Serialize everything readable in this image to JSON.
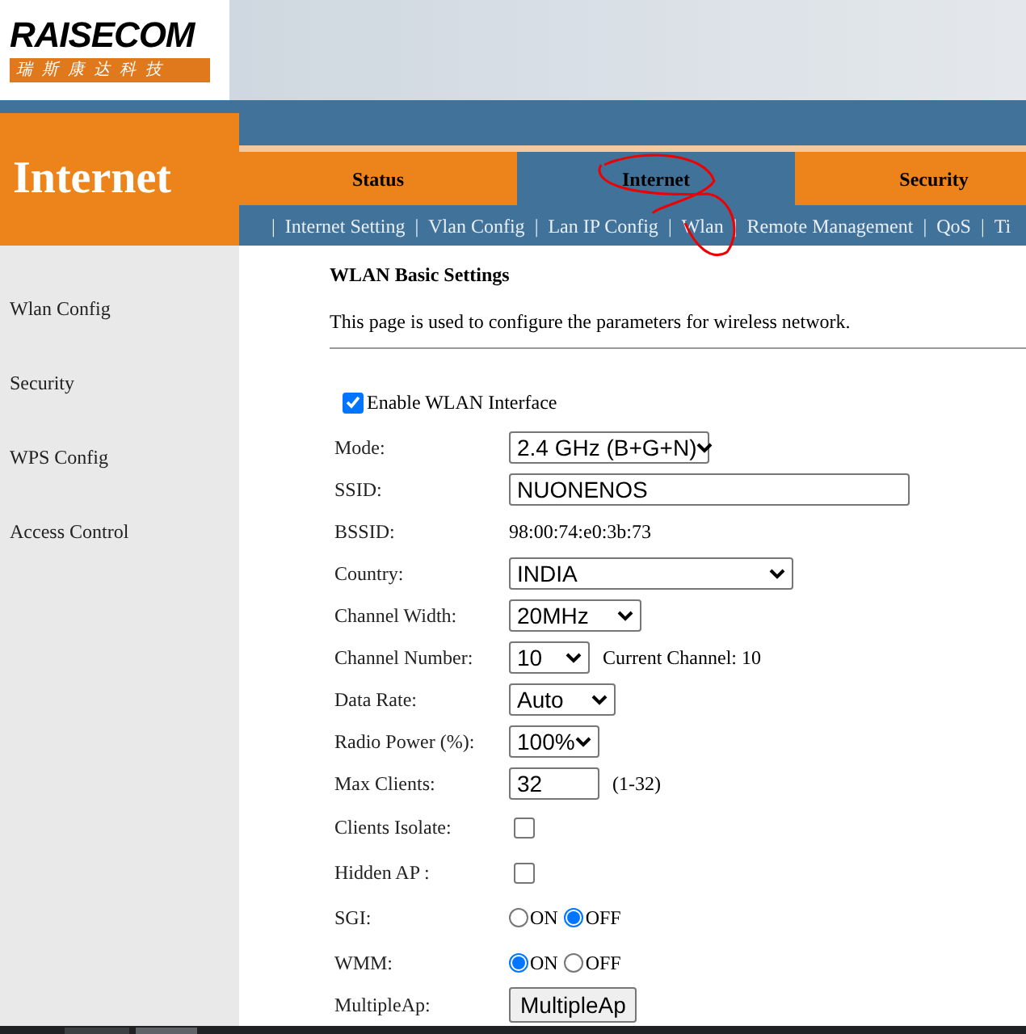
{
  "logo": {
    "name": "RAISECOM",
    "tagline": "瑞斯康达科技"
  },
  "section_title": "Internet",
  "tabs": [
    {
      "label": "Status",
      "selected": false
    },
    {
      "label": "Internet",
      "selected": true
    },
    {
      "label": "Security",
      "selected": false
    }
  ],
  "subnav": {
    "separator": "|",
    "items": [
      "Internet Setting",
      "Vlan Config",
      "Lan IP Config",
      "Wlan",
      "Remote Management",
      "QoS",
      "Ti"
    ]
  },
  "sidebar": {
    "items": [
      "Wlan Config",
      "Security",
      "WPS Config",
      "Access Control"
    ]
  },
  "content": {
    "title": "WLAN Basic Settings",
    "description": "This page is used to configure the parameters for wireless network.",
    "enable": {
      "label": "Enable WLAN Interface",
      "checked": true
    },
    "fields": [
      {
        "kind": "select",
        "label": "Mode:",
        "value": "2.4 GHz (B+G+N)"
      },
      {
        "kind": "text",
        "label": "SSID:",
        "value": "NUONENOS"
      },
      {
        "kind": "static",
        "label": "BSSID:",
        "value": "98:00:74:e0:3b:73"
      },
      {
        "kind": "select",
        "label": "Country:",
        "value": "INDIA"
      },
      {
        "kind": "select",
        "label": "Channel Width:",
        "value": "20MHz"
      },
      {
        "kind": "select",
        "label": "Channel Number:",
        "value": "10",
        "note": "Current Channel: 10"
      },
      {
        "kind": "select",
        "label": "Data Rate:",
        "value": "Auto"
      },
      {
        "kind": "select",
        "label": "Radio Power (%):",
        "value": "100%"
      },
      {
        "kind": "text",
        "label": "Max Clients:",
        "value": "32",
        "note": "(1-32)"
      },
      {
        "kind": "checkbox",
        "label": "Clients Isolate:",
        "checked": false
      },
      {
        "kind": "checkbox",
        "label": "Hidden AP :",
        "checked": false
      },
      {
        "kind": "radio",
        "label": "SGI:",
        "options": [
          {
            "label": "ON",
            "selected": false
          },
          {
            "label": "OFF",
            "selected": true
          }
        ]
      },
      {
        "kind": "radio",
        "label": "WMM:",
        "options": [
          {
            "label": "ON",
            "selected": true
          },
          {
            "label": "OFF",
            "selected": false
          }
        ]
      },
      {
        "kind": "button",
        "label": "MultipleAp:",
        "value": "MultipleAp"
      }
    ]
  }
}
